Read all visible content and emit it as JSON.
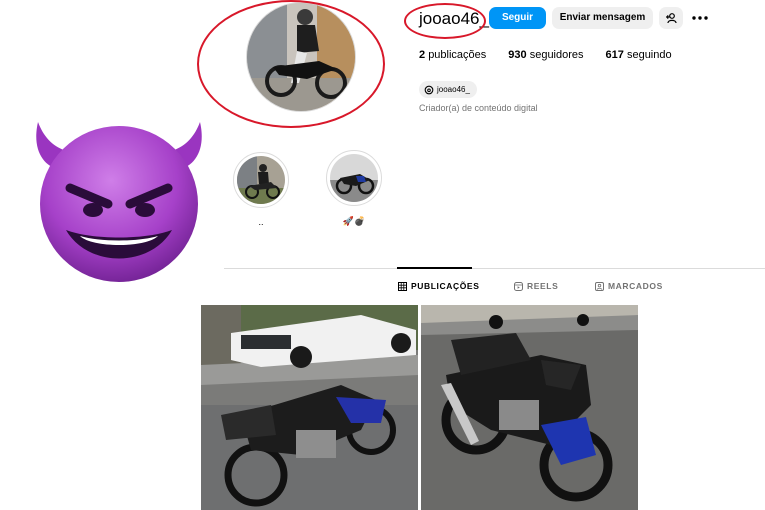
{
  "profile": {
    "username": "jooao46_",
    "follow_label": "Seguir",
    "message_label": "Enviar mensagem",
    "add_icon": "person-add-icon",
    "more_icon": "more-horizontal-icon",
    "stats": {
      "posts_count": "2",
      "posts_label": "publicações",
      "followers_count": "930",
      "followers_label": "seguidores",
      "following_count": "617",
      "following_label": "seguindo"
    },
    "threads_handle": "jooao46_",
    "category": "Criador(a) de conteúdo digital"
  },
  "highlights": [
    {
      "label": ".."
    },
    {
      "label": "🚀💣"
    }
  ],
  "tabs": [
    {
      "label": "PUBLICAÇÕES",
      "icon": "grid-icon",
      "active": true
    },
    {
      "label": "REELS",
      "icon": "reels-icon",
      "active": false
    },
    {
      "label": "MARCADOS",
      "icon": "tagged-icon",
      "active": false
    }
  ],
  "colors": {
    "follow_button": "#0095f6",
    "annotation_red": "#d8182a",
    "emoji_purple": "#a641c9"
  }
}
